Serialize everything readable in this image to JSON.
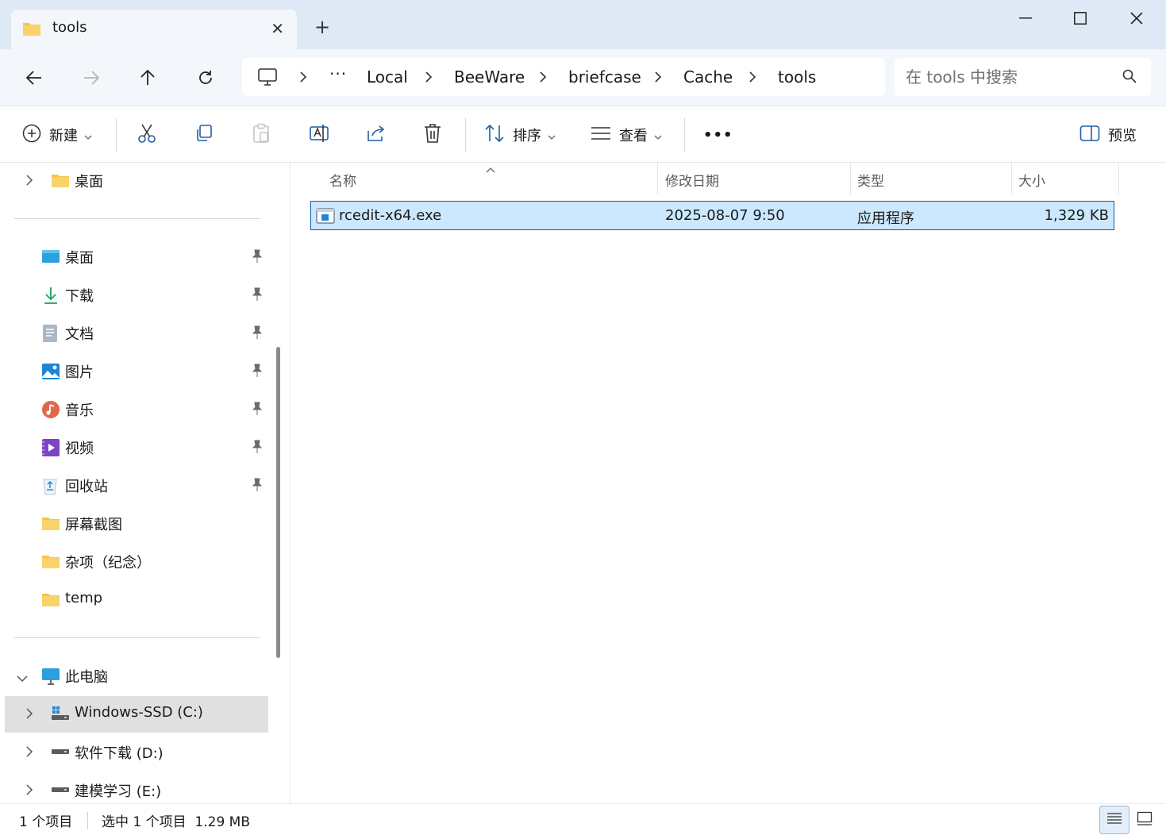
{
  "tab": {
    "title": "tools",
    "close": "✕"
  },
  "newtab": "+",
  "breadcrumb": [
    "Local",
    "BeeWare",
    "briefcase",
    "Cache",
    "tools"
  ],
  "search": {
    "placeholder": "在 tools 中搜索"
  },
  "commands": {
    "new_label": "新建",
    "sort_label": "排序",
    "view_label": "查看",
    "more_label": "•••",
    "preview_label": "预览"
  },
  "sidebar": {
    "top": {
      "label": "桌面"
    },
    "quick": [
      {
        "label": "桌面",
        "icon": "desktop-icon"
      },
      {
        "label": "下载",
        "icon": "download-icon"
      },
      {
        "label": "文档",
        "icon": "documents-icon"
      },
      {
        "label": "图片",
        "icon": "pictures-icon"
      },
      {
        "label": "音乐",
        "icon": "music-icon"
      },
      {
        "label": "视频",
        "icon": "videos-icon"
      },
      {
        "label": "回收站",
        "icon": "recycle-bin-icon"
      },
      {
        "label": "屏幕截图",
        "icon": "folder-icon"
      },
      {
        "label": "杂项（纪念）",
        "icon": "folder-icon"
      },
      {
        "label": "temp",
        "icon": "folder-icon"
      }
    ],
    "this_pc": "此电脑",
    "drives": [
      {
        "label": "Windows-SSD (C:)"
      },
      {
        "label": "软件下载 (D:)"
      },
      {
        "label": "建模学习 (E:)"
      }
    ]
  },
  "columns": {
    "name": "名称",
    "modified": "修改日期",
    "type": "类型",
    "size": "大小"
  },
  "files": [
    {
      "name": "rcedit-x64.exe",
      "modified": "2025-08-07 9:50",
      "type": "应用程序",
      "size": "1,329 KB"
    }
  ],
  "status": {
    "count": "1 个项目",
    "selected": "选中 1 个项目  1.29 MB"
  },
  "colors": {
    "accent": "#0b5cad",
    "selection": "#cce8ff",
    "titlebar": "#dfe9f5",
    "folder": "#f6c445"
  }
}
